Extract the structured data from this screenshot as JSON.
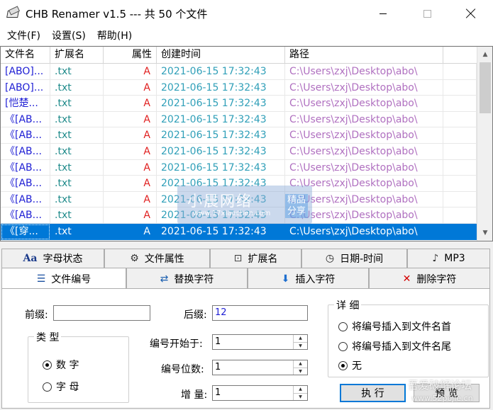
{
  "window": {
    "title": "CHB Renamer v1.5 --- 共 50 个文件"
  },
  "menu": {
    "items": [
      "文件(F)",
      "设置(S)",
      "帮助(H)"
    ]
  },
  "list": {
    "columns": [
      "文件名",
      "扩展名",
      "属性",
      "创建时间",
      "路径"
    ],
    "rows": [
      {
        "name": "[ABO]...",
        "ext": ".txt",
        "attr": "A",
        "time": "2021-06-15 17:32:43",
        "path": "C:\\Users\\zxj\\Desktop\\abo\\"
      },
      {
        "name": "[ABO]...",
        "ext": ".txt",
        "attr": "A",
        "time": "2021-06-15 17:32:43",
        "path": "C:\\Users\\zxj\\Desktop\\abo\\"
      },
      {
        "name": "[恺楚...",
        "ext": ".txt",
        "attr": "A",
        "time": "2021-06-15 17:32:43",
        "path": "C:\\Users\\zxj\\Desktop\\abo\\"
      },
      {
        "name": "《[AB...",
        "ext": ".txt",
        "attr": "A",
        "time": "2021-06-15 17:32:43",
        "path": "C:\\Users\\zxj\\Desktop\\abo\\"
      },
      {
        "name": "《[AB...",
        "ext": ".txt",
        "attr": "A",
        "time": "2021-06-15 17:32:43",
        "path": "C:\\Users\\zxj\\Desktop\\abo\\"
      },
      {
        "name": "《[AB...",
        "ext": ".txt",
        "attr": "A",
        "time": "2021-06-15 17:32:43",
        "path": "C:\\Users\\zxj\\Desktop\\abo\\"
      },
      {
        "name": "《[AB...",
        "ext": ".txt",
        "attr": "A",
        "time": "2021-06-15 17:32:43",
        "path": "C:\\Users\\zxj\\Desktop\\abo\\"
      },
      {
        "name": "《[AB...",
        "ext": ".txt",
        "attr": "A",
        "time": "2021-06-15 17:32:43",
        "path": "C:\\Users\\zxj\\Desktop\\abo\\"
      },
      {
        "name": "《[AB...",
        "ext": ".txt",
        "attr": "A",
        "time": "2021-06-15 17:32:43",
        "path": "C:\\Users\\zxj\\Desktop\\abo\\"
      },
      {
        "name": "《[AB...",
        "ext": ".txt",
        "attr": "A",
        "time": "2021-06-15 17:32:43",
        "path": "C:\\Users\\zxj\\Desktop\\abo\\"
      },
      {
        "name": "《[穿...",
        "ext": ".txt",
        "attr": "A",
        "time": "2021-06-15 17:32:43",
        "path": "C:\\Users\\zxj\\Desktop\\abo\\",
        "selected": true
      }
    ]
  },
  "tabs": {
    "row1": [
      {
        "label": "字母状态",
        "icon": "letter-case-icon",
        "glyph": "Aa"
      },
      {
        "label": "文件属性",
        "icon": "gear-icon",
        "glyph": "⚙"
      },
      {
        "label": "扩展名",
        "icon": "extension-icon",
        "glyph": "⊡"
      },
      {
        "label": "日期-时间",
        "icon": "clock-icon",
        "glyph": "◷"
      },
      {
        "label": "MP3",
        "icon": "music-file-icon",
        "glyph": "♪"
      }
    ],
    "row2": [
      {
        "label": "文件编号",
        "icon": "numbered-list-icon",
        "glyph": "☰",
        "active": true
      },
      {
        "label": "替换字符",
        "icon": "replace-icon",
        "glyph": "⇄"
      },
      {
        "label": "插入字符",
        "icon": "insert-arrow-icon",
        "glyph": "⬇"
      },
      {
        "label": "删除字符",
        "icon": "delete-x-icon",
        "glyph": "✕"
      }
    ]
  },
  "numbering": {
    "prefix_label": "前缀:",
    "prefix_value": "",
    "suffix_label": "后缀:",
    "suffix_value": "12",
    "type_group_title": "类 型",
    "type_options": [
      "数 字",
      "字 母"
    ],
    "type_selected": 0,
    "start_label": "编号开始于:",
    "start_value": "1",
    "digits_label": "编号位数:",
    "digits_value": "1",
    "increment_label": "增 量:",
    "increment_value": "1",
    "detail_group_title": "详 细",
    "detail_options": [
      "将编号插入到文件名首",
      "将编号插入到文件名尾",
      "无"
    ],
    "detail_selected": 2,
    "execute_label": "执 行",
    "preview_label": "预 览"
  },
  "watermarks": {
    "top_title": "小晨网络",
    "top_tag": "精品\n分享",
    "top_sub": "www.17xiaochen.com",
    "bottom_title": "吾爱破解论坛",
    "bottom_sub": "www.52pojie.cn"
  }
}
